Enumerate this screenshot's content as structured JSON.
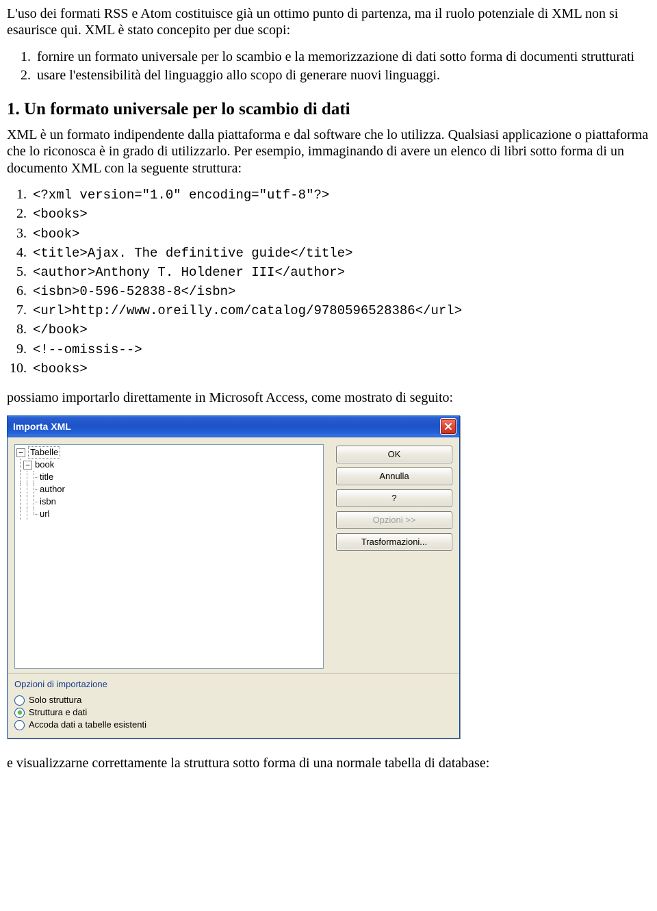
{
  "intro": "L'uso dei formati RSS e Atom costituisce già un ottimo punto di partenza, ma il ruolo potenziale di XML non si esaurisce qui. XML è stato concepito per due scopi:",
  "scopi": [
    "fornire un formato universale per lo scambio e la memorizzazione di dati sotto forma di documenti strutturati",
    "usare l'estensibilità del linguaggio allo scopo di generare nuovi linguaggi."
  ],
  "section_title": "1. Un formato universale per lo scambio di dati",
  "section_body": "XML è un formato indipendente dalla piattaforma e dal software che lo utilizza. Qualsiasi applicazione o piattaforma che lo riconosca è in grado di utilizzarlo. Per esempio, immaginando di avere un elenco di libri sotto forma di un documento XML con la seguente struttura:",
  "code_lines": [
    "<?xml version=\"1.0\" encoding=\"utf-8\"?>",
    "<books>",
    "<book>",
    "<title>Ajax. The definitive guide</title>",
    "<author>Anthony T. Holdener III</author>",
    "<isbn>0-596-52838-8</isbn>",
    "<url>http://www.oreilly.com/catalog/9780596528386</url>",
    "</book>",
    "<!--omissis-->",
    "<books>"
  ],
  "after_code": "possiamo importarlo direttamente in Microsoft Access, come mostrato di seguito:",
  "closing": "e visualizzarne correttamente la struttura sotto forma di una normale tabella di database:",
  "dialog": {
    "title": "Importa XML",
    "tree": {
      "root": "Tabelle",
      "child": "book",
      "leaves": [
        "title",
        "author",
        "isbn",
        "url"
      ]
    },
    "buttons": {
      "ok": "OK",
      "cancel": "Annulla",
      "help": "?",
      "options": "Opzioni >>",
      "transform": "Trasformazioni..."
    },
    "footer_title": "Opzioni di importazione",
    "radios": [
      {
        "label": "Solo struttura",
        "checked": false
      },
      {
        "label": "Struttura e dati",
        "checked": true
      },
      {
        "label": "Accoda dati a tabelle esistenti",
        "checked": false
      }
    ]
  }
}
